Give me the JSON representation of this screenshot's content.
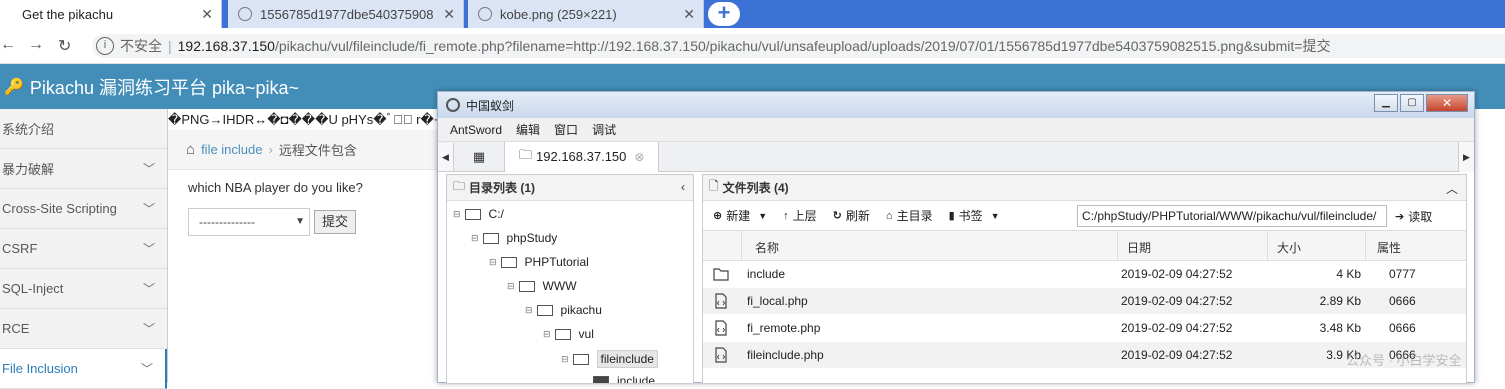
{
  "browser": {
    "tabs": [
      {
        "title": "Get the pikachu",
        "active": true
      },
      {
        "title": "1556785d1977dbe540375908",
        "active": false
      },
      {
        "title": "kobe.png (259×221)",
        "active": false
      }
    ],
    "new_tab": "+",
    "security": "不安全",
    "url_host": "192.168.37.150",
    "url_path": "/pikachu/vul/fileinclude/fi_remote.php?filename=http://192.168.37.150/pikachu/vul/unsafeupload/uploads/2019/07/01/1556785d1977dbe5403759082515.png&submit=提交"
  },
  "app": {
    "title": "Pikachu 漏洞练习平台 pika~pika~",
    "sidebar": [
      {
        "label": "系统介绍",
        "chevron": false
      },
      {
        "label": "暴力破解",
        "chevron": true
      },
      {
        "label": "Cross-Site Scripting",
        "chevron": true
      },
      {
        "label": "CSRF",
        "chevron": true
      },
      {
        "label": "SQL-Inject",
        "chevron": true
      },
      {
        "label": "RCE",
        "chevron": true
      },
      {
        "label": "File Inclusion",
        "chevron": true
      }
    ],
    "garbage_text": "�PNG→IHDR↔�◘���U pHYs�ﾞ�ﾞ r�+�ﾞ",
    "breadcrumb_link": "file include",
    "breadcrumb_current": "远程文件包含",
    "question": "which NBA player do you like?",
    "select_value": "--------------",
    "submit_label": "提交"
  },
  "antsword": {
    "window_title": "中国蚁剑",
    "menu": [
      "AntSword",
      "编辑",
      "窗口",
      "调试"
    ],
    "tab_label": "192.168.37.150",
    "dir_panel_title": "目录列表 (1)",
    "tree": [
      {
        "label": "C:/"
      },
      {
        "label": "phpStudy"
      },
      {
        "label": "PHPTutorial"
      },
      {
        "label": "WWW"
      },
      {
        "label": "pikachu"
      },
      {
        "label": "vul"
      },
      {
        "label": "fileinclude"
      },
      {
        "label": "include"
      }
    ],
    "file_panel_title": "文件列表 (4)",
    "toolbar": {
      "new": "新建",
      "up": "上层",
      "refresh": "刷新",
      "home": "主目录",
      "bookmark": "书签",
      "path": "C:/phpStudy/PHPTutorial/WWW/pikachu/vul/fileinclude/",
      "read": "读取"
    },
    "columns": {
      "name": "名称",
      "date": "日期",
      "size": "大小",
      "attr": "属性"
    },
    "files": [
      {
        "name": "include",
        "date": "2019-02-09 04:27:52",
        "size": "4 Kb",
        "attr": "0777",
        "type": "folder"
      },
      {
        "name": "fi_local.php",
        "date": "2019-02-09 04:27:52",
        "size": "2.89 Kb",
        "attr": "0666",
        "type": "php"
      },
      {
        "name": "fi_remote.php",
        "date": "2019-02-09 04:27:52",
        "size": "3.48 Kb",
        "attr": "0666",
        "type": "php"
      },
      {
        "name": "fileinclude.php",
        "date": "2019-02-09 04:27:52",
        "size": "3.9 Kb",
        "attr": "0666",
        "type": "php"
      }
    ]
  },
  "watermark": "公众号 · 小白学安全"
}
